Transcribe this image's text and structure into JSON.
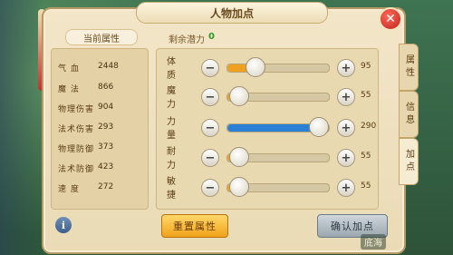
{
  "window": {
    "title": "人物加点",
    "close_label": "✕"
  },
  "left_panel": {
    "header": "当前属性",
    "stats": [
      {
        "label": "气  血",
        "value": "2448"
      },
      {
        "label": "魔  法",
        "value": "866"
      },
      {
        "label": "物理伤害",
        "value": "904"
      },
      {
        "label": "法术伤害",
        "value": "293"
      },
      {
        "label": "物理防御",
        "value": "373"
      },
      {
        "label": "法术防御",
        "value": "423"
      },
      {
        "label": "速  度",
        "value": "272"
      }
    ]
  },
  "right_panel": {
    "remaining_label": "剩余潜力",
    "remaining_value": "0",
    "attributes": [
      {
        "label": "体 质",
        "value": "95",
        "level": 0.28,
        "color": "#f0a020"
      },
      {
        "label": "魔 力",
        "value": "55",
        "level": 0.12,
        "color": "#f0a020"
      },
      {
        "label": "力 量",
        "value": "290",
        "level": 0.9,
        "color": "#2a7fd6"
      },
      {
        "label": "耐 力",
        "value": "55",
        "level": 0.12,
        "color": "#f0a020"
      },
      {
        "label": "敏 捷",
        "value": "55",
        "level": 0.12,
        "color": "#f0a020"
      }
    ],
    "minus_label": "−",
    "plus_label": "+"
  },
  "tabs": [
    {
      "label": "属性",
      "active": false
    },
    {
      "label": "信息",
      "active": false
    },
    {
      "label": "加点",
      "active": true
    }
  ],
  "buttons": {
    "reset": "重置属性",
    "confirm": "确认加点",
    "info": "i"
  },
  "watermark": "底海"
}
